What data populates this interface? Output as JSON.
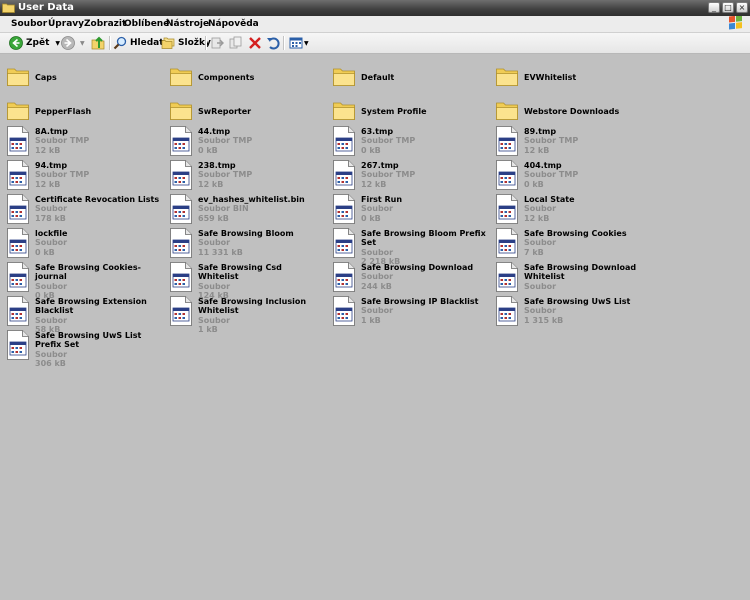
{
  "window": {
    "title": "User Data",
    "folder_icon": "folder-icon"
  },
  "window_controls": [
    "minimize-icon",
    "maximize-icon",
    "close-icon"
  ],
  "menu": [
    "Soubor",
    "Úpravy",
    "Zobrazit",
    "Oblíbené",
    "Nástroje",
    "Nápověda"
  ],
  "toolbar": {
    "back_label": "Zpět",
    "search_label": "Hledat",
    "folders_label": "Složky"
  },
  "items": [
    {
      "name": "Caps",
      "kind": "folder"
    },
    {
      "name": "Components",
      "kind": "folder"
    },
    {
      "name": "Default",
      "kind": "folder"
    },
    {
      "name": "EVWhitelist",
      "kind": "folder"
    },
    {
      "name": "PepperFlash",
      "kind": "folder"
    },
    {
      "name": "SwReporter",
      "kind": "folder"
    },
    {
      "name": "System Profile",
      "kind": "folder"
    },
    {
      "name": "Webstore Downloads",
      "kind": "folder"
    },
    {
      "name": "8A.tmp",
      "kind": "file",
      "type": "Soubor TMP",
      "size": "12 kB"
    },
    {
      "name": "44.tmp",
      "kind": "file",
      "type": "Soubor TMP",
      "size": "0 kB"
    },
    {
      "name": "63.tmp",
      "kind": "file",
      "type": "Soubor TMP",
      "size": "0 kB"
    },
    {
      "name": "89.tmp",
      "kind": "file",
      "type": "Soubor TMP",
      "size": "12 kB"
    },
    {
      "name": "94.tmp",
      "kind": "file",
      "type": "Soubor TMP",
      "size": "12 kB"
    },
    {
      "name": "238.tmp",
      "kind": "file",
      "type": "Soubor TMP",
      "size": "12 kB"
    },
    {
      "name": "267.tmp",
      "kind": "file",
      "type": "Soubor TMP",
      "size": "12 kB"
    },
    {
      "name": "404.tmp",
      "kind": "file",
      "type": "Soubor TMP",
      "size": "0 kB"
    },
    {
      "name": "Certificate Revocation Lists",
      "kind": "file",
      "type": "Soubor",
      "size": "178 kB"
    },
    {
      "name": "ev_hashes_whitelist.bin",
      "kind": "file",
      "type": "Soubor BIN",
      "size": "659 kB"
    },
    {
      "name": "First Run",
      "kind": "file",
      "type": "Soubor",
      "size": "0 kB"
    },
    {
      "name": "Local State",
      "kind": "file",
      "type": "Soubor",
      "size": "12 kB"
    },
    {
      "name": "lockfile",
      "kind": "file",
      "type": "Soubor",
      "size": "0 kB"
    },
    {
      "name": "Safe Browsing Bloom",
      "kind": "file",
      "type": "Soubor",
      "size": "11 331 kB"
    },
    {
      "name": "Safe Browsing Bloom Prefix Set",
      "kind": "file",
      "type": "Soubor",
      "size": "2 218 kB"
    },
    {
      "name": "Safe Browsing Cookies",
      "kind": "file",
      "type": "Soubor",
      "size": "7 kB"
    },
    {
      "name": "Safe Browsing Cookies-journal",
      "kind": "file",
      "type": "Soubor",
      "size": "0 kB"
    },
    {
      "name": "Safe Browsing Csd Whitelist",
      "kind": "file",
      "type": "Soubor",
      "size": "124 kB"
    },
    {
      "name": "Safe Browsing Download",
      "kind": "file",
      "type": "Soubor",
      "size": "244 kB"
    },
    {
      "name": "Safe Browsing Download Whitelist",
      "kind": "file",
      "type": "Soubor",
      "size": ""
    },
    {
      "name": "Safe Browsing Extension Blacklist",
      "kind": "file",
      "type": "Soubor",
      "size": "58 kB"
    },
    {
      "name": "Safe Browsing Inclusion Whitelist",
      "kind": "file",
      "type": "Soubor",
      "size": "1 kB"
    },
    {
      "name": "Safe Browsing IP Blacklist",
      "kind": "file",
      "type": "Soubor",
      "size": "1 kB"
    },
    {
      "name": "Safe Browsing UwS List",
      "kind": "file",
      "type": "Soubor",
      "size": "1 315 kB"
    },
    {
      "name": "Safe Browsing UwS List Prefix Set",
      "kind": "file",
      "type": "Soubor",
      "size": "306 kB"
    }
  ]
}
